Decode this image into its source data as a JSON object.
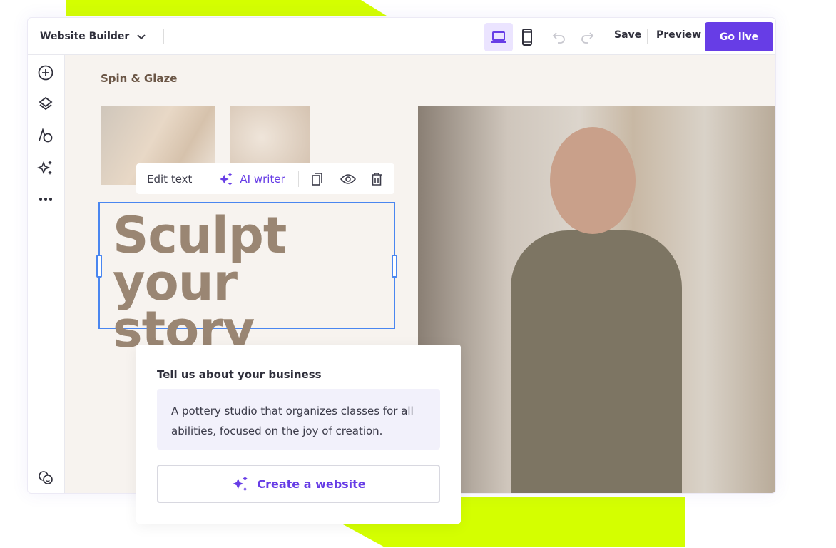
{
  "header": {
    "title": "Website Builder",
    "save": "Save",
    "preview": "Preview",
    "go_live": "Go live"
  },
  "site": {
    "name": "Spin & Glaze",
    "heading_line1": "Sculpt",
    "heading_line2": "your story"
  },
  "toolbar": {
    "edit_text": "Edit text",
    "ai_writer": "AI writer"
  },
  "card": {
    "title": "Tell us about your business",
    "description": "A pottery studio that organizes classes for all abilities, focused on the joy of creation.",
    "create_button": "Create a website"
  },
  "colors": {
    "accent": "#673de6",
    "lime": "#d4ff00",
    "heading": "#9a8673",
    "selection": "#4a86f0"
  }
}
